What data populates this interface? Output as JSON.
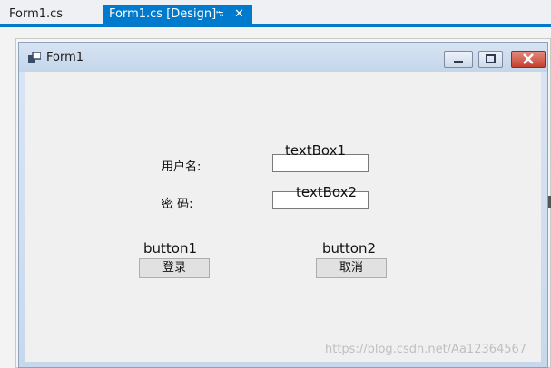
{
  "tabs": [
    {
      "label": "Form1.cs",
      "active": false
    },
    {
      "label": "Form1.cs [Design]",
      "active": true,
      "pin_glyph": "⭾",
      "close_glyph": "✕"
    }
  ],
  "form": {
    "title": "Form1",
    "labels": {
      "username": "用户名:",
      "password": "密  码:"
    },
    "textboxes": [
      {
        "name": "textBox1"
      },
      {
        "name": "textBox2"
      }
    ],
    "buttons": [
      {
        "name": "button1",
        "text": "登录"
      },
      {
        "name": "button2",
        "text": "取消"
      }
    ]
  },
  "watermark": "https://blog.csdn.net/Aa12364567",
  "colors": {
    "accent": "#007acc",
    "close_button": "#c4402f"
  }
}
